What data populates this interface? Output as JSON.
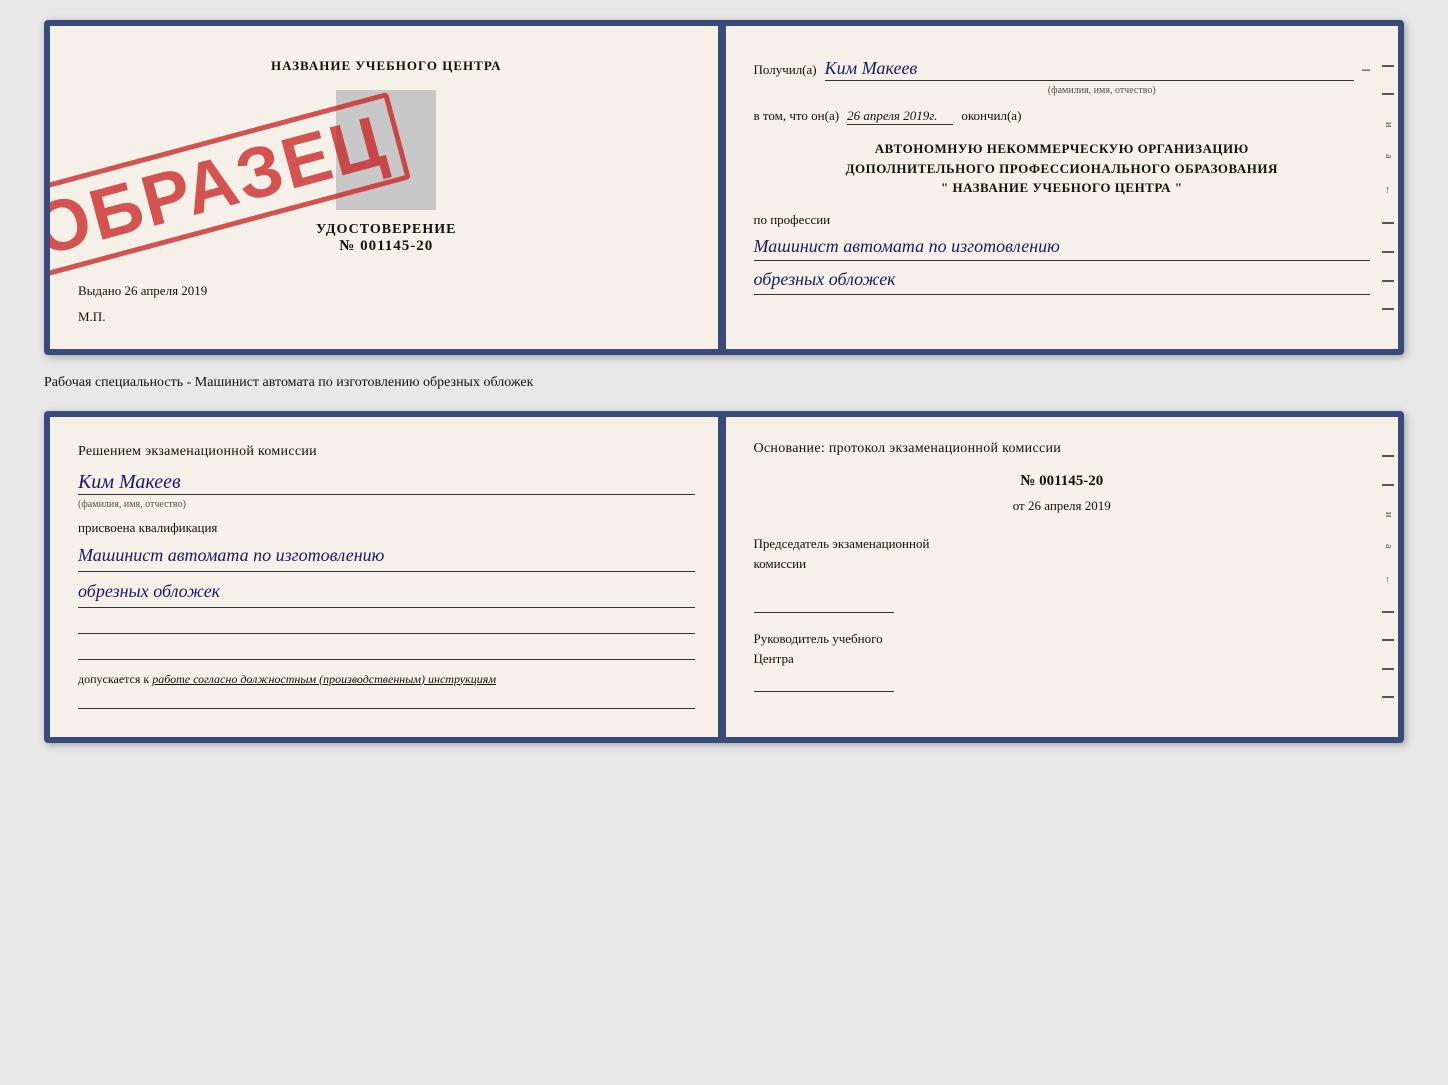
{
  "top_document": {
    "left": {
      "title": "НАЗВАНИЕ УЧЕБНОГО ЦЕНТРА",
      "udostoverenie_label": "УДОСТОВЕРЕНИЕ",
      "number": "№ 001145-20",
      "vydano_label": "Выдано",
      "vydano_date": "26 апреля 2019",
      "mp_label": "М.П.",
      "stamp_text": "ОБРАЗЕЦ"
    },
    "right": {
      "poluchil_label": "Получил(а)",
      "recipient_name": "Ким Макеев",
      "fio_subtitle": "(фамилия, имя, отчество)",
      "vtom_label": "в том, что он(а)",
      "date_value": "26 апреля 2019г.",
      "okonchil_label": "окончил(а)",
      "org_line1": "АВТОНОМНУЮ НЕКОММЕРЧЕСКУЮ ОРГАНИЗАЦИЮ",
      "org_line2": "ДОПОЛНИТЕЛЬНОГО ПРОФЕССИОНАЛЬНОГО ОБРАЗОВАНИЯ",
      "org_line3": "\"  НАЗВАНИЕ УЧЕБНОГО ЦЕНТРА  \"",
      "po_professii_label": "по профессии",
      "professiya_line1": "Машинист автомата по изготовлению",
      "professiya_line2": "обрезных обложек"
    }
  },
  "separator": {
    "text": "Рабочая специальность - Машинист автомата по изготовлению обрезных обложек"
  },
  "bottom_document": {
    "left": {
      "resheniem_label": "Решением экзаменационной комиссии",
      "name": "Ким Макеев",
      "fio_subtitle": "(фамилия, имя, отчество)",
      "prisvoena_label": "присвоена квалификация",
      "kvalif_line1": "Машинист автомата по изготовлению",
      "kvalif_line2": "обрезных обложек",
      "dopuskaetsya_text": "допускается к",
      "dopuskaetsya_cursive": "работе согласно должностным (производственным) инструкциям"
    },
    "right": {
      "osnovanie_label": "Основание: протокол экзаменационной комиссии",
      "protocol_num": "№ 001145-20",
      "ot_label": "от",
      "ot_date": "26 апреля 2019",
      "predsedatel_line1": "Председатель экзаменационной",
      "predsedatel_line2": "комиссии",
      "rukovoditel_line1": "Руководитель учебного",
      "rukovoditel_line2": "Центра"
    }
  }
}
